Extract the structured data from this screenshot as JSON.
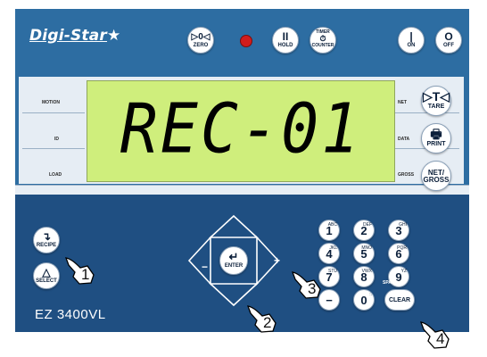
{
  "brand": {
    "name": "Digi-Star",
    "star": "★"
  },
  "top_buttons": {
    "zero": {
      "symbol": "▷0◁",
      "label": "ZERO"
    },
    "hold": {
      "symbol": "II",
      "label": "HOLD"
    },
    "timer": {
      "top": "TIMER",
      "symbol": "⏱",
      "label": "COUNTER"
    },
    "on": {
      "symbol": "|",
      "label": "ON"
    },
    "off": {
      "symbol": "O",
      "label": "OFF"
    }
  },
  "indicators": {
    "motion": "MOTION",
    "id": "ID",
    "load": "LOAD",
    "net": "NET",
    "data": "DATA",
    "gross": "GROSS"
  },
  "display": {
    "text": "REC-01"
  },
  "side_buttons": {
    "tare": {
      "symbol": "▷T◁",
      "label": "TARE"
    },
    "print": {
      "symbol": "🖶",
      "label": "PRINT"
    },
    "net_gross": {
      "symbol": "NET/",
      "label": "GROSS"
    }
  },
  "left_buttons": {
    "recipe": {
      "symbol": "↴",
      "label": "RECIPE"
    },
    "select": {
      "symbol": "△",
      "label": "SELECT"
    }
  },
  "model": "EZ 3400VL",
  "dpad": {
    "enter_symbol": "↵",
    "enter_label": "ENTER",
    "plus": "+",
    "minus": "−"
  },
  "keypad": [
    {
      "key": "1",
      "sub": "ABC"
    },
    {
      "key": "2",
      "sub": "DEF"
    },
    {
      "key": "3",
      "sub": "GHI"
    },
    {
      "key": "4",
      "sub": "JKL"
    },
    {
      "key": "5",
      "sub": "MNO"
    },
    {
      "key": "6",
      "sub": "PQR"
    },
    {
      "key": "7",
      "sub": "STU"
    },
    {
      "key": "8",
      "sub": "VWX"
    },
    {
      "key": "9",
      "sub": "YZ"
    },
    {
      "key": "−",
      "sub": ""
    },
    {
      "key": "0",
      "sub": ":."
    },
    {
      "key": "CLEAR",
      "sub": ""
    }
  ],
  "keypad_extra": {
    "space": "SPACE"
  },
  "callouts": [
    "1",
    "2",
    "3",
    "4"
  ]
}
